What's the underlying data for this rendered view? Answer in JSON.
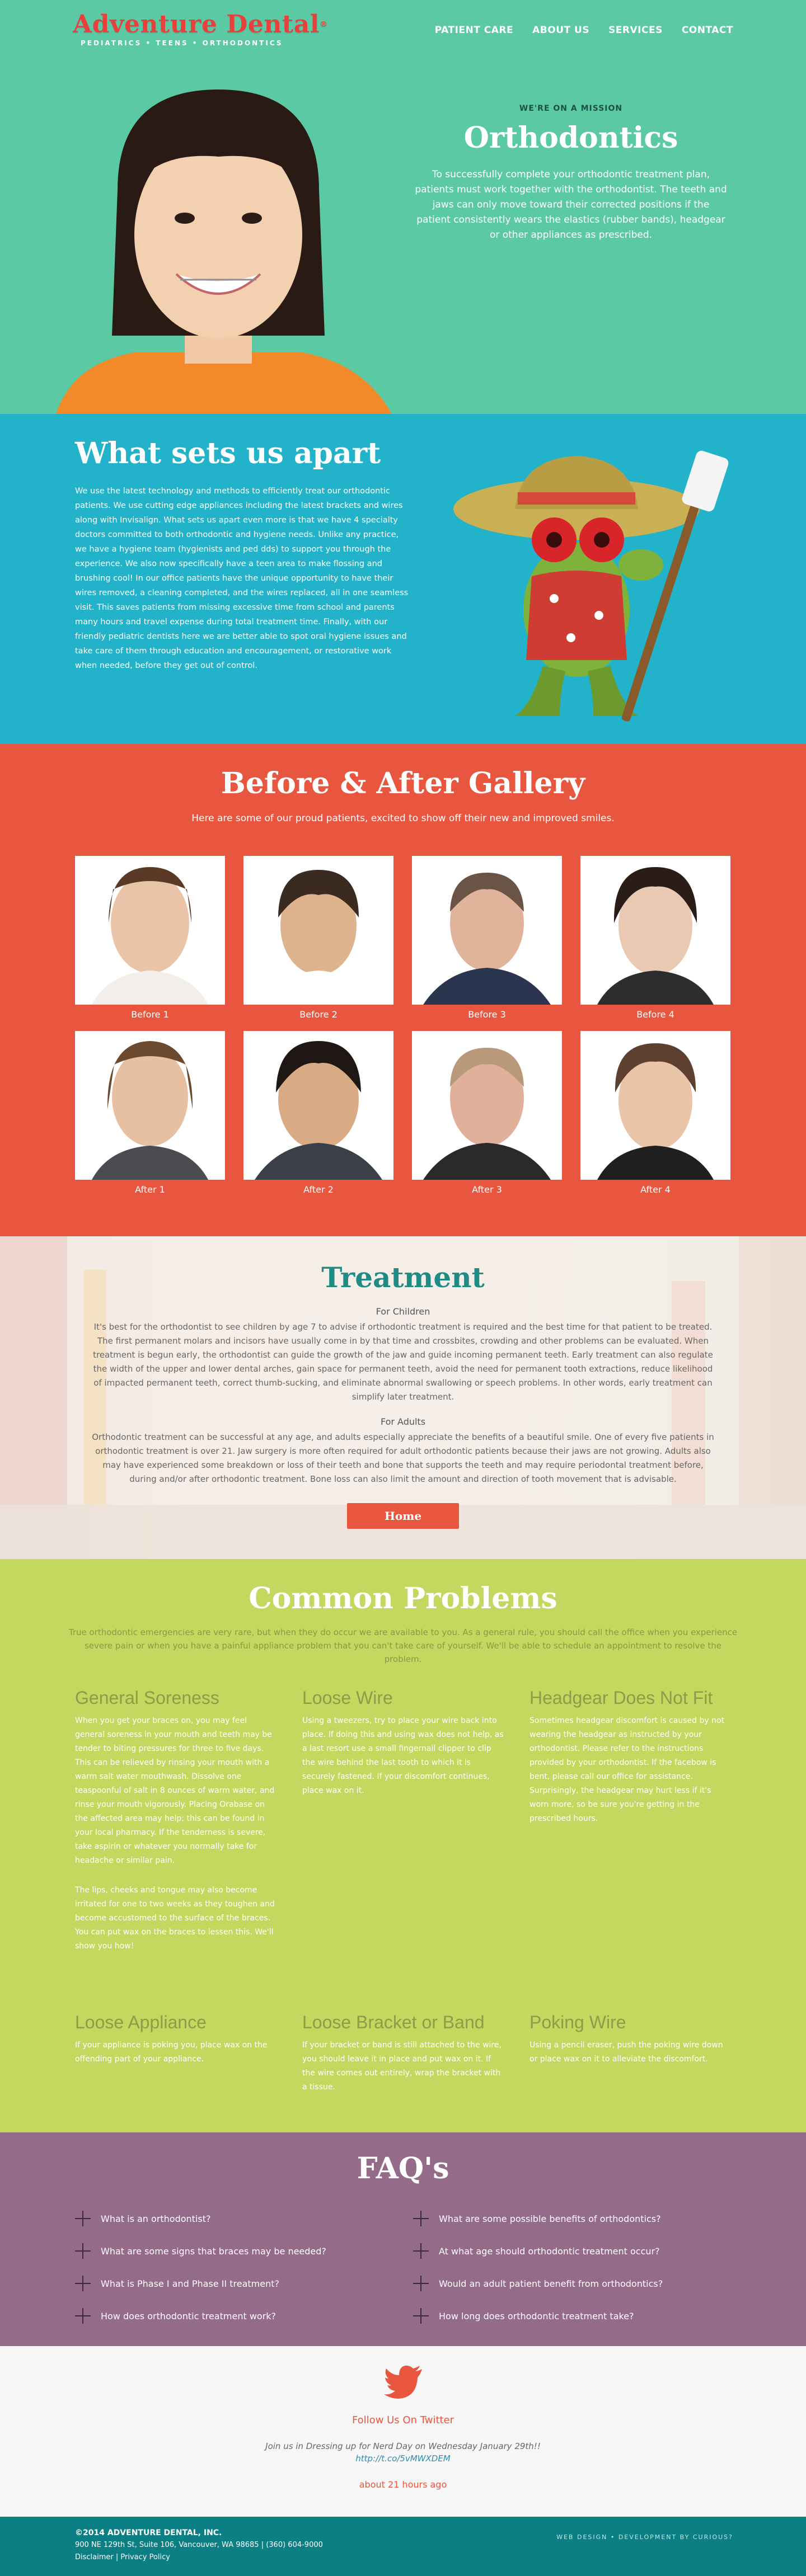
{
  "header": {
    "logo_text": "Adventure Dental",
    "logo_tm": "®",
    "tagline": "PEDIATRICS • TEENS • ORTHODONTICS",
    "nav": [
      "PATIENT CARE",
      "ABOUT US",
      "SERVICES",
      "CONTACT"
    ]
  },
  "hero": {
    "kicker": "WE'RE ON A MISSION",
    "title": "Orthodontics",
    "description": "To successfully complete your orthodontic treatment plan, patients must work together with the orthodontist. The teeth and jaws can only move toward their corrected positions if the patient consistently wears the elastics (rubber bands), headgear or other appliances as prescribed."
  },
  "apart": {
    "title": "What sets us apart",
    "body": "We use the latest technology and methods to efficiently treat our orthodontic patients. We use cutting edge appliances including the latest brackets and wires along with Invisalign. What sets us apart even more is that we have 4 specialty doctors committed to both orthodontic and hygiene needs. Unlike any practice, we have a hygiene team (hygienists and ped dds) to support you through the experience. We also now specifically have a teen area to make flossing and brushing cool! In our office patients have the unique opportunity to have their wires removed, a cleaning completed, and the wires replaced, all in one seamless visit. This saves patients from missing excessive time from school and parents many hours and travel expense during total treatment time. Finally, with our friendly pediatric dentists here we are better able to spot oral hygiene issues and take care of them through education and encouragement, or restorative work when needed, before they get out of control."
  },
  "gallery": {
    "title": "Before & After Gallery",
    "subtitle": "Here are some of our proud patients, excited to show off their new and improved smiles.",
    "tiles": [
      {
        "label": "Before 1",
        "bg": "#e9d3c4"
      },
      {
        "label": "Before 2",
        "bg": "#e6d4cb"
      },
      {
        "label": "Before 3",
        "bg": "#ecdcd2"
      },
      {
        "label": "Before 4",
        "bg": "#ddd7d2"
      },
      {
        "label": "After 1",
        "bg": "#e9d3c4"
      },
      {
        "label": "After 2",
        "bg": "#e3d0c4"
      },
      {
        "label": "After 3",
        "bg": "#ecdcd2"
      },
      {
        "label": "After 4",
        "bg": "#ddd7d2"
      }
    ]
  },
  "treatment": {
    "title": "Treatment",
    "children_heading": "For Children",
    "children_body": "It's best for the orthodontist to see children by age 7 to advise if orthodontic treatment is required and the best time for that patient to be treated. The first permanent molars and incisors have usually come in by that time and crossbites, crowding and other problems can be evaluated. When treatment is begun early, the orthodontist can guide the growth of the jaw and guide incoming permanent teeth. Early treatment can also regulate the width of the upper and lower dental arches, gain space for permanent teeth, avoid the need for permanent tooth extractions, reduce likelihood of impacted permanent teeth, correct thumb-sucking, and eliminate abnormal swallowing or speech problems. In other words, early treatment can simplify later treatment.",
    "adults_heading": "For Adults",
    "adults_body": "Orthodontic treatment can be successful at any age, and adults especially appreciate the benefits of a beautiful smile. One of every five patients in orthodontic treatment is over 21. Jaw surgery is more often required for adult orthodontic patients because their jaws are not growing. Adults also may have experienced some breakdown or loss of their teeth and bone that supports the teeth and may require periodontal treatment before, during and/or after orthodontic treatment. Bone loss can also limit the amount and direction of tooth movement that is advisable.",
    "button": "Home"
  },
  "problems": {
    "title": "Common Problems",
    "intro": "True orthodontic emergencies are very rare, but when they do occur we are available to you. As a general rule, you should call the office when you experience severe pain or when you have a painful appliance problem that you can't take care of yourself. We'll be able to schedule an appointment to resolve the problem.",
    "items": [
      {
        "title": "General Soreness",
        "body": "When you get your braces on, you may feel general soreness in your mouth and teeth may be tender to biting pressures for three to five days. This can be relieved by rinsing your mouth with a warm salt water mouthwash. Dissolve one teaspoonful of salt in 8 ounces of warm water, and rinse your mouth vigorously. Placing Orabase on the affected area may help; this can be found in your local pharmacy. If the tenderness is severe, take aspirin or whatever you normally take for headache or similar pain.",
        "body2": "The lips, cheeks and tongue may also become irritated for one to two weeks as they toughen and become accustomed to the surface of the braces. You can put wax on the braces to lessen this. We'll show you how!"
      },
      {
        "title": "Loose Wire",
        "body": "Using a tweezers, try to place your wire back into place. If doing this and using wax does not help, as a last resort use a small fingernail clipper to clip the wire behind the last tooth to which it is securely fastened. If your discomfort continues, place wax on it."
      },
      {
        "title": "Headgear Does Not Fit",
        "body": "Sometimes headgear discomfort is caused by not wearing the headgear as instructed by your orthodontist. Please refer to the instructions provided by your orthodontist. If the facebow is bent, please call our office for assistance. Surprisingly, the headgear may hurt less if it's worn more, so be sure you're getting in the prescribed hours."
      },
      {
        "title": "Loose Appliance",
        "body": "If your appliance is poking you, place wax on the offending part of your appliance."
      },
      {
        "title": "Loose Bracket or Band",
        "body": "If your bracket or band is still attached to the wire, you should leave it in place and put wax on it. If the wire comes out entirely, wrap the bracket with a tissue."
      },
      {
        "title": "Poking Wire",
        "body": "Using a pencil eraser, push the poking wire down or place wax on it to alleviate the discomfort."
      }
    ]
  },
  "faq": {
    "title": "FAQ's",
    "items": [
      "What is an orthodontist?",
      "What are some possible benefits of orthodontics?",
      "What are some signs that braces may be needed?",
      "At what age should orthodontic treatment occur?",
      "What is Phase I and Phase II treatment?",
      "Would an adult patient benefit from orthodontics?",
      "How does orthodontic treatment work?",
      "How long does orthodontic treatment take?"
    ]
  },
  "twitter": {
    "heading": "Follow Us On Twitter",
    "tweet": "Join us in Dressing up for Nerd Day on Wednesday January 29th!!",
    "link": "http://t.co/5vMWXDEM",
    "time": "about 21 hours ago"
  },
  "footer": {
    "copyright": "©2014 ADVENTURE DENTAL, INC.",
    "address": "900 NE 129th St, Suite 106, Vancouver, WA 98685 | (360) 604-9000",
    "links": [
      "Disclaimer",
      "Privacy Policy"
    ],
    "separator": " | ",
    "credits_prefix": "WEB DESIGN • DEVELOPMENT BY ",
    "credits_name": "CURIOUS?"
  },
  "colors": {
    "hero_bg": "#5bcaa4",
    "apart_bg": "#22b2c9",
    "gallery_bg": "#e8563f",
    "problems_bg": "#c2d85e",
    "faq_bg": "#956b8a",
    "footer_bg": "#0b7f83",
    "brand_red": "#e8413d"
  }
}
